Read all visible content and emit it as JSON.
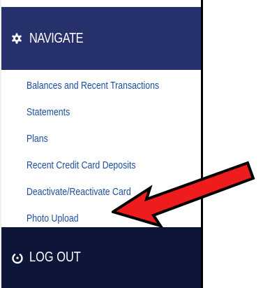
{
  "nav": {
    "title": "NAVIGATE",
    "icon": "gear-icon",
    "items": [
      {
        "label": "Balances and Recent Transactions"
      },
      {
        "label": "Statements"
      },
      {
        "label": "Plans"
      },
      {
        "label": "Recent Credit Card Deposits"
      },
      {
        "label": "Deactivate/Reactivate Card"
      },
      {
        "label": "Photo Upload"
      }
    ]
  },
  "logout": {
    "label": "LOG OUT",
    "icon": "power-icon"
  },
  "colors": {
    "header_bg": "#26306b",
    "logout_bg": "#0d1538",
    "link": "#1c4fa0",
    "arrow": "#ee1c1c"
  }
}
